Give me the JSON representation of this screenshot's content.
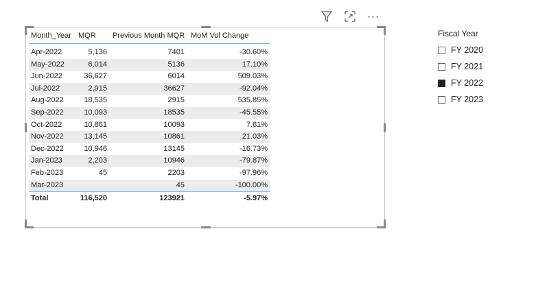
{
  "table": {
    "columns": [
      "Month_Year",
      "MQR",
      "Previous Month MQR",
      "MoM Vol Change"
    ],
    "rows": [
      {
        "month": "Apr-2022",
        "mqr": "5,136",
        "prev": "7401",
        "mom": "-30.60%"
      },
      {
        "month": "May-2022",
        "mqr": "6,014",
        "prev": "5136",
        "mom": "17.10%"
      },
      {
        "month": "Jun-2022",
        "mqr": "36,627",
        "prev": "6014",
        "mom": "509.03%"
      },
      {
        "month": "Jul-2022",
        "mqr": "2,915",
        "prev": "36627",
        "mom": "-92.04%"
      },
      {
        "month": "Aug-2022",
        "mqr": "18,535",
        "prev": "2915",
        "mom": "535.85%"
      },
      {
        "month": "Sep-2022",
        "mqr": "10,093",
        "prev": "18535",
        "mom": "-45.55%"
      },
      {
        "month": "Oct-2022",
        "mqr": "10,861",
        "prev": "10093",
        "mom": "7.61%"
      },
      {
        "month": "Nov-2022",
        "mqr": "13,145",
        "prev": "10861",
        "mom": "21.03%"
      },
      {
        "month": "Dec-2022",
        "mqr": "10,946",
        "prev": "13145",
        "mom": "-16.73%"
      },
      {
        "month": "Jan-2023",
        "mqr": "2,203",
        "prev": "10946",
        "mom": "-79.87%"
      },
      {
        "month": "Feb-2023",
        "mqr": "45",
        "prev": "2203",
        "mom": "-97.96%"
      },
      {
        "month": "Mar-2023",
        "mqr": "",
        "prev": "45",
        "mom": "-100.00%"
      }
    ],
    "total": {
      "label": "Total",
      "mqr": "116,520",
      "prev": "123921",
      "mom": "-5.97%"
    }
  },
  "slicer": {
    "title": "Fiscal Year",
    "items": [
      {
        "label": "FY 2020",
        "checked": false
      },
      {
        "label": "FY 2021",
        "checked": false
      },
      {
        "label": "FY 2022",
        "checked": true
      },
      {
        "label": "FY 2023",
        "checked": false
      }
    ]
  },
  "visual_header": {
    "icons": [
      "filter-icon",
      "focus-mode-icon",
      "more-options-icon"
    ],
    "more_glyph": "···"
  },
  "colors": {
    "alt_row": "#ececec",
    "header_rule": "#8ab0d8",
    "checked_fill": "#252423"
  }
}
